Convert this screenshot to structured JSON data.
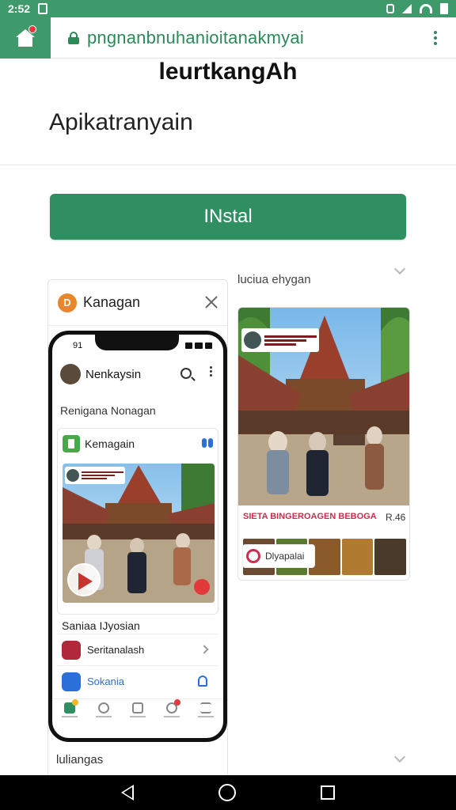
{
  "status_bar": {
    "time": "2:52"
  },
  "browser": {
    "url": "pngnanbnuhanioitanakmyai"
  },
  "page": {
    "title": "leurtkangAh",
    "subtitle": "Apikatranyain",
    "install_label": "INstal"
  },
  "right_panel": {
    "label": "luciua ehygan",
    "red_caption": "SIETA BINGEROAGEN BEBOGA",
    "number": "R.46",
    "badge_label": "Dlyapalai"
  },
  "left_card": {
    "header_logo_letter": "D",
    "header_title": "Kanagan",
    "footer_label": "luliangas",
    "phone": {
      "time": "91",
      "profile_name": "Nenkaysin",
      "section_title": "Renigana Nonagan",
      "box_title": "Kemagain",
      "item_text": "Saniaa IJyosian",
      "row1_label": "Seritanalash",
      "row2_label": "Sokania"
    }
  },
  "colors": {
    "brand_green": "#2f8f63",
    "status_green": "#3e9a6a",
    "accent_red": "#d22b4c",
    "link_blue": "#2b6fd8"
  }
}
